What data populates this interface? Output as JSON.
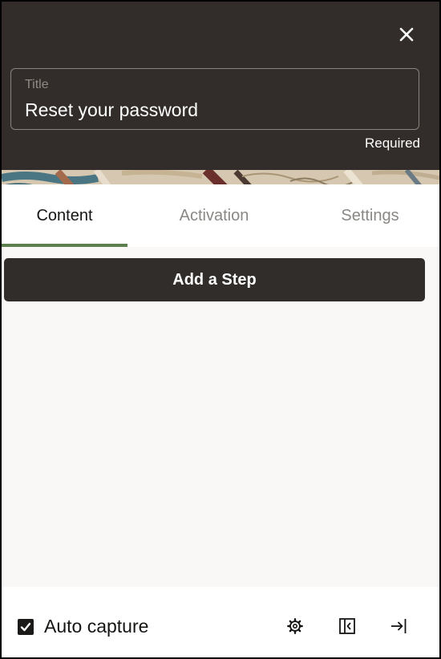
{
  "header": {
    "close_icon": "close-icon",
    "title_field": {
      "label": "Title",
      "value": "Reset your password",
      "required_text": "Required"
    }
  },
  "tabs": [
    {
      "label": "Content",
      "active": true
    },
    {
      "label": "Activation",
      "active": false
    },
    {
      "label": "Settings",
      "active": false
    }
  ],
  "content": {
    "add_step_label": "Add a Step"
  },
  "footer": {
    "auto_capture_label": "Auto capture",
    "auto_capture_checked": true,
    "icons": [
      "gear-icon",
      "collapse-panel-icon",
      "exit-icon"
    ]
  },
  "colors": {
    "header_bg": "#322d2a",
    "active_tab_underline": "#5d7f4e",
    "button_bg": "#312d2a",
    "content_bg": "#f9f8f6"
  }
}
